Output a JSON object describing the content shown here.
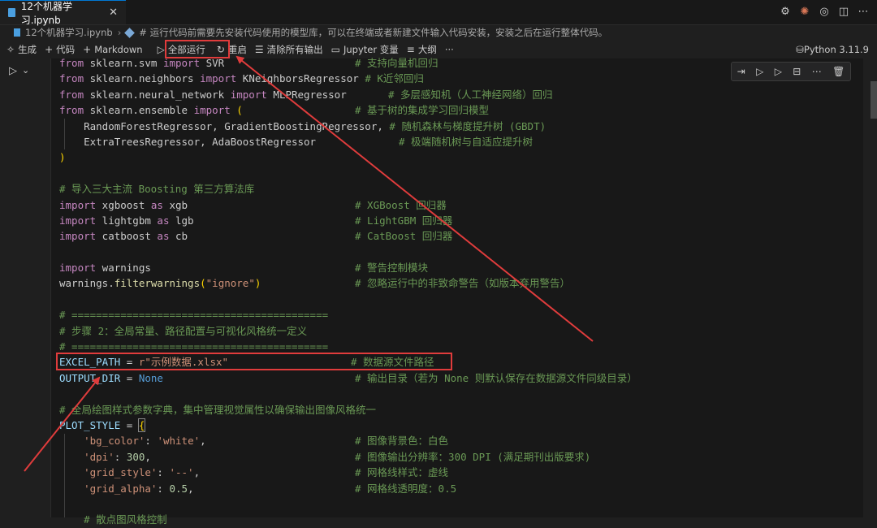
{
  "tab": {
    "title": "12个机器学习.ipynb",
    "close": "✕"
  },
  "breadcrumb": {
    "file": "12个机器学习.ipynb",
    "separator": "›",
    "cell": "# 运行代码前需要先安装代码使用的模型库，可以在终端或者新建文件输入代码安装，安装之后在运行整体代码。"
  },
  "toolbar": {
    "generate": "生成",
    "code": "代码",
    "markdown": "Markdown",
    "run_all": "全部运行",
    "restart": "重启",
    "clear_outputs": "清除所有输出",
    "jupyter_vars": "Jupyter 变量",
    "outline": "大纲",
    "more": "···",
    "kernel": "Python 3.11.9"
  },
  "code": {
    "l01a": "from",
    "l01b": " sklearn.svm ",
    "l01c": "import",
    "l01d": " SVR",
    "l01e": "# 支持向量机回归",
    "l02a": "from",
    "l02b": " sklearn.neighbors ",
    "l02c": "import",
    "l02d": " KNeighborsRegressor ",
    "l02e": "# K近邻回归",
    "l03a": "from",
    "l03b": " sklearn.neural_network ",
    "l03c": "import",
    "l03d": " MLPRegressor",
    "l03e": "# 多层感知机（人工神经网络）回归",
    "l04a": "from",
    "l04b": " sklearn.ensemble ",
    "l04c": "import",
    "l04d": "(",
    "l04e": "# 基于树的集成学习回归模型",
    "l05a": "RandomForestRegressor, GradientBoostingRegressor,",
    "l05e": "# 随机森林与梯度提升树 (GBDT)",
    "l06a": "ExtraTreesRegressor, AdaBoostRegressor",
    "l06e": "# 极端随机树与自适应提升树",
    "l07a": ")",
    "l09a": "# 导入三大主流 Boosting 第三方算法库",
    "l10a": "import",
    "l10b": " xgboost ",
    "l10c": "as",
    "l10d": " xgb",
    "l10e": "# XGBoost 回归器",
    "l11a": "import",
    "l11b": " lightgbm ",
    "l11c": "as",
    "l11d": " lgb",
    "l11e": "# LightGBM 回归器",
    "l12a": "import",
    "l12b": " catboost ",
    "l12c": "as",
    "l12d": " cb",
    "l12e": "# CatBoost 回归器",
    "l14a": "import",
    "l14b": " warnings",
    "l14e": "# 警告控制模块",
    "l15a": "warnings",
    "l15b": ".",
    "l15c": "filterwarnings",
    "l15d": "(",
    "l15s": "\"ignore\"",
    "l15f": ")",
    "l15e": "# 忽略运行中的非致命警告（如版本弃用警告）",
    "l17a": "# ==========================================",
    "l18a": "# 步骤 2：全局常量、路径配置与可视化风格统一定义",
    "l19a": "# ==========================================",
    "l20a": "EXCEL_PATH",
    "l20b": " = ",
    "l20c": "r",
    "l20s": "\"示例数据.xlsx\"",
    "l20e": "# 数据源文件路径",
    "l21a": "OUTPUT_DIR",
    "l21b": " = ",
    "l21c": "None",
    "l21e": "# 输出目录（若为 None 则默认保存在数据源文件同级目录）",
    "l23a": "# 全局绘图样式参数字典，集中管理视觉属性以确保输出图像风格统一",
    "l24a": "PLOT_STYLE",
    "l24b": " = ",
    "l24c": "{",
    "l25k": "'bg_color'",
    "l25c": ": ",
    "l25v": "'white'",
    "l25p": ",",
    "l25e": "# 图像背景色：白色",
    "l26k": "'dpi'",
    "l26c": ": ",
    "l26v": "300",
    "l26p": ",",
    "l26e": "# 图像输出分辨率：300 DPI (满足期刊出版要求)",
    "l27k": "'grid_style'",
    "l27c": ": ",
    "l27v": "'--'",
    "l27p": ",",
    "l27e": "# 网格线样式：虚线",
    "l28k": "'grid_alpha'",
    "l28c": ": ",
    "l28v": "0.5",
    "l28p": ",",
    "l28e": "# 网格线透明度：0.5",
    "l30a": "# 散点图风格控制"
  }
}
